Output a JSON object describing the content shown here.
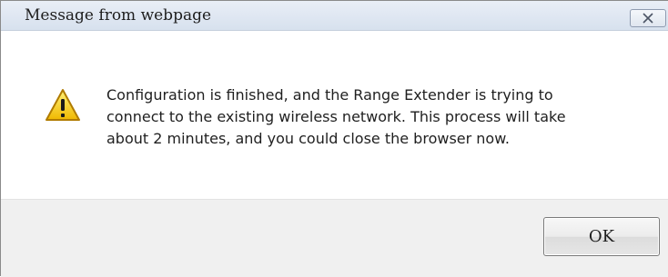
{
  "dialog": {
    "title": "Message from webpage",
    "close_icon": "close-icon",
    "icon": "warning-icon",
    "message": "Configuration is finished, and the Range Extender is trying to\nconnect to the existing wireless network. This process will take\nabout 2 minutes, and you could close the browser now.",
    "ok_label": "OK"
  },
  "colors": {
    "titlebar": "#dfe7f2",
    "footer": "#f0f0f0",
    "warning_yellow": "#f5c400"
  }
}
